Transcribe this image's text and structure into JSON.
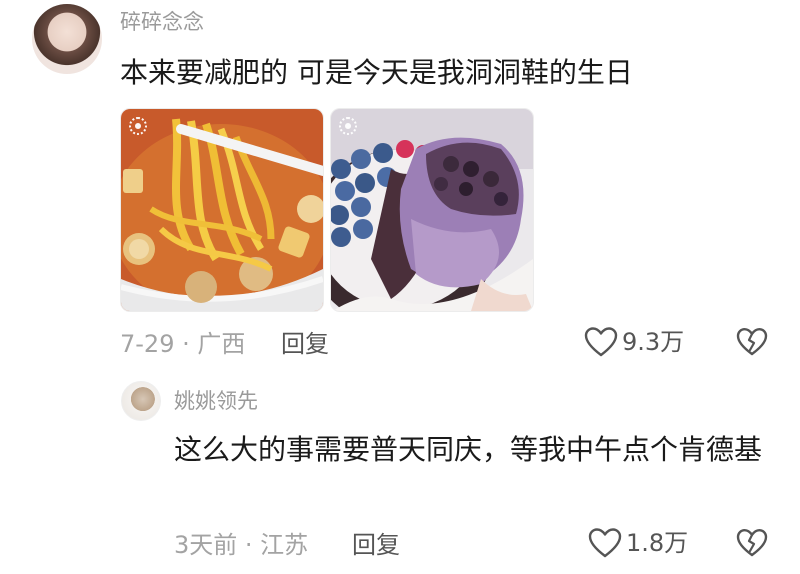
{
  "comments": [
    {
      "username": "碎碎念念",
      "text": "本来要减肥的 可是今天是我洞洞鞋的生日",
      "meta": "7-29 · 广西",
      "reply_label": "回复",
      "likes": "9.3万",
      "images": [
        {
          "icon": "live-photo-icon",
          "subject": "noodle-soup"
        },
        {
          "icon": "live-photo-icon",
          "subject": "blueberry-cake"
        }
      ]
    },
    {
      "username": "姚姚领先",
      "text": "这么大的事需要普天同庆，等我中午点个肯德基",
      "meta": "3天前 · 江苏",
      "reply_label": "回复",
      "likes": "1.8万"
    }
  ],
  "colors": {
    "text_primary": "#1a1a1a",
    "text_secondary": "#9a9a9a",
    "icon_stroke": "#555555"
  }
}
